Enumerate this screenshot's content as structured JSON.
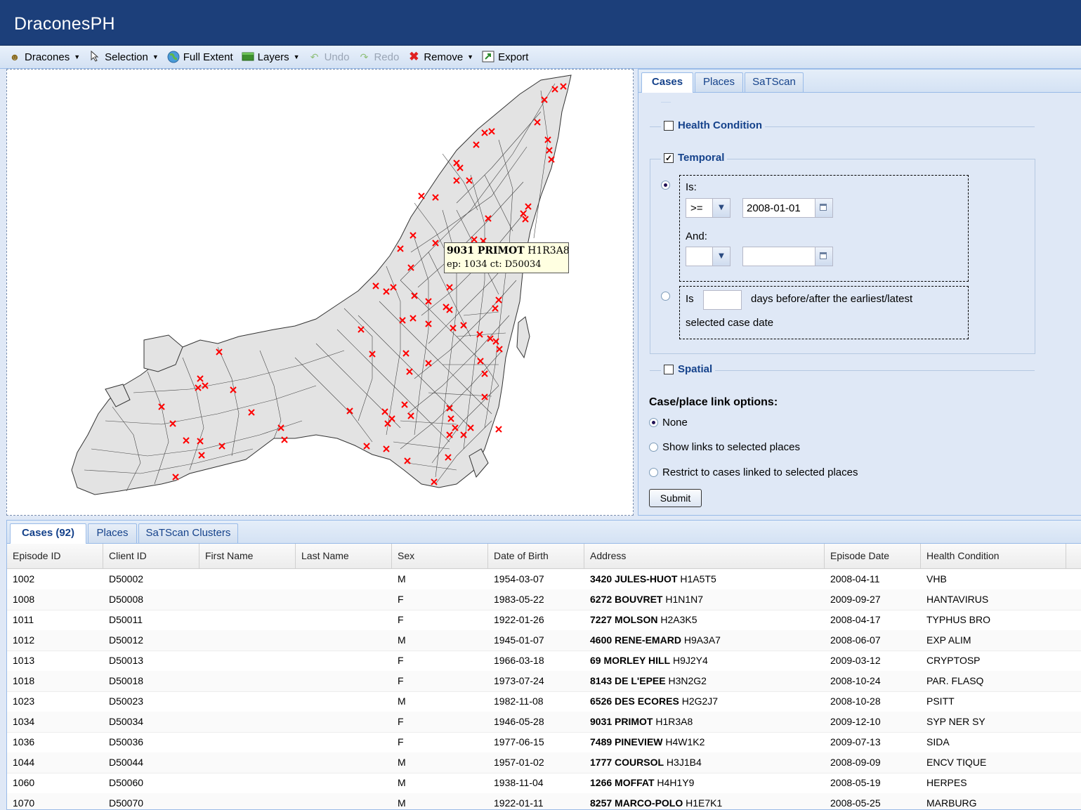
{
  "app": {
    "title": "DraconesPH"
  },
  "toolbar": {
    "dracones": "Dracones",
    "selection": "Selection",
    "full_extent": "Full Extent",
    "layers": "Layers",
    "undo": "Undo",
    "redo": "Redo",
    "remove": "Remove",
    "export": "Export"
  },
  "tooltip": {
    "address": "9031 PRIMOT",
    "postal": "H1R3A8",
    "detail": "ep: 1034 ct: D50034"
  },
  "query_panel": {
    "tabs": [
      "Cases",
      "Places",
      "SaTScan"
    ],
    "active_tab": "Cases",
    "health_condition": {
      "label": "Health Condition",
      "checked": false
    },
    "temporal": {
      "label": "Temporal",
      "checked": true,
      "option_is": {
        "selected": true,
        "is_label": "Is:",
        "operator": ">=",
        "date": "2008-01-01",
        "and_label": "And:",
        "operator2": "",
        "date2": ""
      },
      "option_days": {
        "selected": false,
        "prefix": "Is",
        "value": "",
        "suffix": "days before/after the earliest/latest",
        "suffix2": "selected case date"
      }
    },
    "spatial": {
      "label": "Spatial",
      "checked": false
    },
    "link_options": {
      "heading": "Case/place link options:",
      "options": [
        "None",
        "Show links to selected places",
        "Restrict to cases linked to selected places"
      ],
      "selected": "None"
    },
    "submit": "Submit"
  },
  "results": {
    "tabs": [
      "Cases (92)",
      "Places",
      "SaTScan Clusters"
    ],
    "active_tab": "Cases (92)",
    "columns": [
      "Episode ID",
      "Client ID",
      "First Name",
      "Last Name",
      "Sex",
      "Date of Birth",
      "Address",
      "Episode Date",
      "Health Condition"
    ],
    "rows": [
      {
        "episode": "1002",
        "client": "D50002",
        "first": "",
        "last": "",
        "sex": "M",
        "dob": "1954-03-07",
        "street": "3420 JULES-HUOT",
        "postal": "H1A5T5",
        "date": "2008-04-11",
        "condition": "VHB"
      },
      {
        "episode": "1008",
        "client": "D50008",
        "first": "",
        "last": "",
        "sex": "F",
        "dob": "1983-05-22",
        "street": "6272 BOUVRET",
        "postal": "H1N1N7",
        "date": "2009-09-27",
        "condition": "HANTAVIRUS"
      },
      {
        "episode": "1011",
        "client": "D50011",
        "first": "",
        "last": "",
        "sex": "F",
        "dob": "1922-01-26",
        "street": "7227 MOLSON",
        "postal": "H2A3K5",
        "date": "2008-04-17",
        "condition": "TYPHUS BRO"
      },
      {
        "episode": "1012",
        "client": "D50012",
        "first": "",
        "last": "",
        "sex": "M",
        "dob": "1945-01-07",
        "street": "4600 RENE-EMARD",
        "postal": "H9A3A7",
        "date": "2008-06-07",
        "condition": "EXP ALIM"
      },
      {
        "episode": "1013",
        "client": "D50013",
        "first": "",
        "last": "",
        "sex": "F",
        "dob": "1966-03-18",
        "street": "69 MORLEY HILL",
        "postal": "H9J2Y4",
        "date": "2009-03-12",
        "condition": "CRYPTOSP"
      },
      {
        "episode": "1018",
        "client": "D50018",
        "first": "",
        "last": "",
        "sex": "F",
        "dob": "1973-07-24",
        "street": "8143 DE L'EPEE",
        "postal": "H3N2G2",
        "date": "2008-10-24",
        "condition": "PAR. FLASQ"
      },
      {
        "episode": "1023",
        "client": "D50023",
        "first": "",
        "last": "",
        "sex": "M",
        "dob": "1982-11-08",
        "street": "6526 DES ECORES",
        "postal": "H2G2J7",
        "date": "2008-10-28",
        "condition": "PSITT"
      },
      {
        "episode": "1034",
        "client": "D50034",
        "first": "",
        "last": "",
        "sex": "F",
        "dob": "1946-05-28",
        "street": "9031 PRIMOT",
        "postal": "H1R3A8",
        "date": "2009-12-10",
        "condition": "SYP NER SY"
      },
      {
        "episode": "1036",
        "client": "D50036",
        "first": "",
        "last": "",
        "sex": "F",
        "dob": "1977-06-15",
        "street": "7489 PINEVIEW",
        "postal": "H4W1K2",
        "date": "2009-07-13",
        "condition": "SIDA"
      },
      {
        "episode": "1044",
        "client": "D50044",
        "first": "",
        "last": "",
        "sex": "M",
        "dob": "1957-01-02",
        "street": "1777 COURSOL",
        "postal": "H3J1B4",
        "date": "2008-09-09",
        "condition": "ENCV TIQUE"
      },
      {
        "episode": "1060",
        "client": "D50060",
        "first": "",
        "last": "",
        "sex": "M",
        "dob": "1938-11-04",
        "street": "1266 MOFFAT",
        "postal": "H4H1Y9",
        "date": "2008-05-19",
        "condition": "HERPES"
      },
      {
        "episode": "1070",
        "client": "D50070",
        "first": "",
        "last": "",
        "sex": "M",
        "dob": "1922-01-11",
        "street": "8257 MARCO-POLO",
        "postal": "H1E7K1",
        "date": "2008-05-25",
        "condition": "MARBURG"
      }
    ]
  },
  "colors": {
    "header": "#1c3f7a",
    "accent": "#15428b",
    "case_marker": "#ff0000",
    "map_fill": "#e3e3e3"
  }
}
